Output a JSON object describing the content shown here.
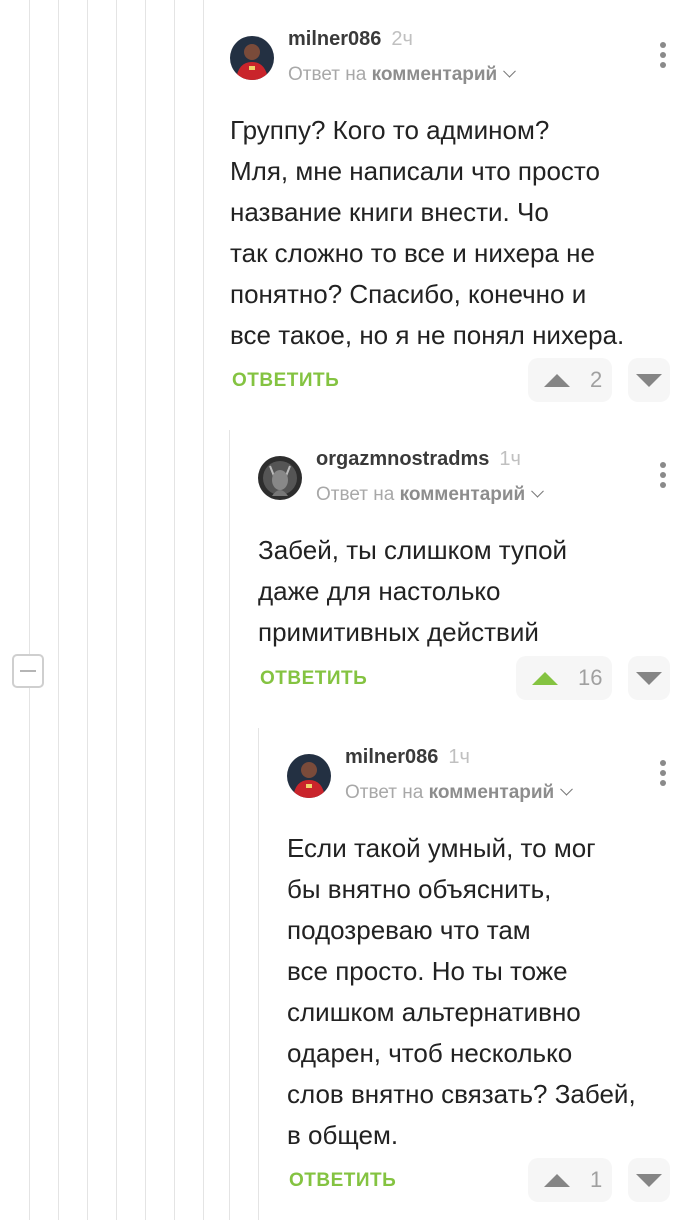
{
  "comments": [
    {
      "username": "milner086",
      "time": "2ч",
      "reply_prefix": "Ответ на",
      "reply_target": "комментарий",
      "text": "Группу? Кого то админом?\nМля, мне написали что просто\nназвание книги внести. Чо\nтак сложно то все и нихера не\nпонятно? Спасибо, конечно и\nвсе такое, но я не понял нихера.",
      "reply_label": "ОТВЕТИТЬ",
      "votes": "2",
      "upvoted": false
    },
    {
      "username": "orgazmnostradms",
      "time": "1ч",
      "reply_prefix": "Ответ на",
      "reply_target": "комментарий",
      "text": "Забей, ты слишком тупой\nдаже для настолько\nпримитивных действий",
      "reply_label": "ОТВЕТИТЬ",
      "votes": "16",
      "upvoted": true
    },
    {
      "username": "milner086",
      "time": "1ч",
      "reply_prefix": "Ответ на",
      "reply_target": "комментарий",
      "text": "Если такой умный, то мог\nбы внятно объяснить,\nподозреваю что там\nвсе просто. Но ты тоже\nслишком альтернативно\nодарен, чтоб несколько\nслов внятно связать? Забей,\nв общем.",
      "reply_label": "ОТВЕТИТЬ",
      "votes": "1",
      "upvoted": false
    }
  ],
  "colors": {
    "accent_green": "#84c341",
    "thread_line": "#e4e4e4"
  },
  "icons": {
    "collapse": "minus-square-icon",
    "more": "more-vertical-icon",
    "upvote": "triangle-up-icon",
    "downvote": "triangle-down-icon"
  }
}
